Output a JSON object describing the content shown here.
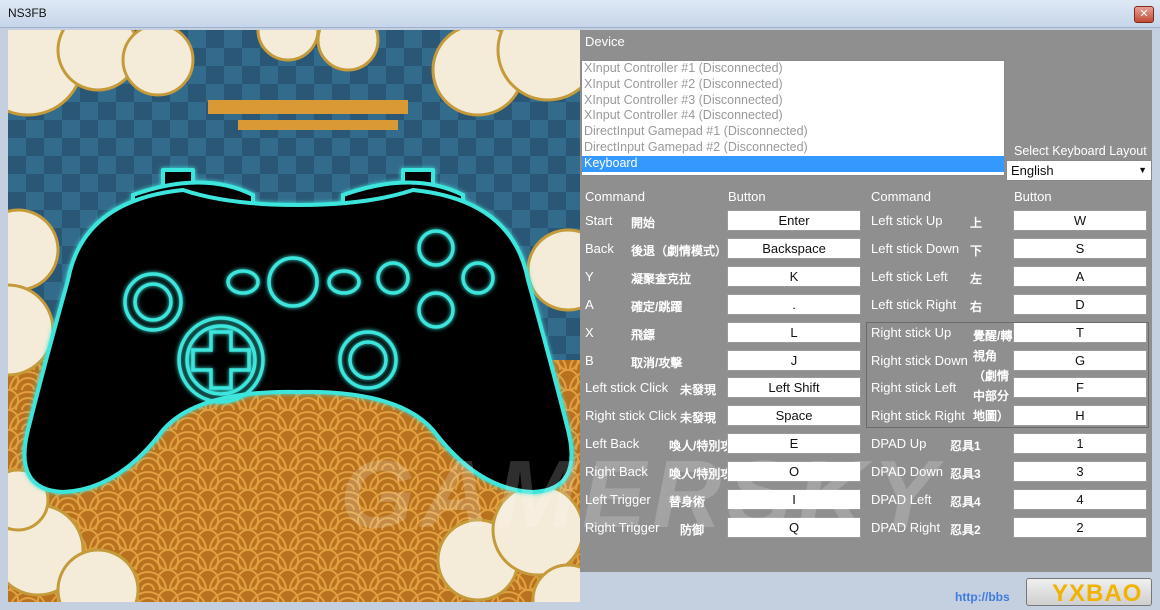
{
  "window": {
    "title": "NS3FB",
    "close_glyph": "✕"
  },
  "device": {
    "label": "Device",
    "items": [
      "XInput Controller #1 (Disconnected)",
      "XInput Controller #2 (Disconnected)",
      "XInput Controller #3 (Disconnected)",
      "XInput Controller #4 (Disconnected)",
      "DirectInput Gamepad #1 (Disconnected)",
      "DirectInput Gamepad #2 (Disconnected)",
      "Keyboard"
    ],
    "selected": "Keyboard"
  },
  "keyboard_layout": {
    "label": "Select Keyboard Layout",
    "value": "English"
  },
  "headers": {
    "command": "Command",
    "button": "Button"
  },
  "left_rows": [
    {
      "command": "Start",
      "desc": "開始",
      "button": "Enter"
    },
    {
      "command": "Back",
      "desc": "後退（劇情模式）",
      "button": "Backspace"
    },
    {
      "command": "Y",
      "desc": "凝聚查克拉",
      "button": "K"
    },
    {
      "command": "A",
      "desc": "確定/跳躍",
      "button": "."
    },
    {
      "command": "X",
      "desc": "飛鏢",
      "button": "L"
    },
    {
      "command": "B",
      "desc": "取消/攻擊",
      "button": "J"
    },
    {
      "command": "Left stick Click",
      "desc": "未發現",
      "button": "Left Shift"
    },
    {
      "command": "Right stick Click",
      "desc": "未發現",
      "button": "Space"
    },
    {
      "command": "Left Back",
      "desc": "喚人/特別攻擊",
      "button": "E"
    },
    {
      "command": "Right Back",
      "desc": "喚人/特別攻擊",
      "button": "O"
    },
    {
      "command": "Left Trigger",
      "desc": "替身術",
      "button": "I"
    },
    {
      "command": "Right Trigger",
      "desc": "防御",
      "button": "Q"
    }
  ],
  "right_rows_top": [
    {
      "command": "Left stick Up",
      "desc": "上",
      "button": "W"
    },
    {
      "command": "Left stick Down",
      "desc": "下",
      "button": "S"
    },
    {
      "command": "Left stick Left",
      "desc": "左",
      "button": "A"
    },
    {
      "command": "Left stick Right",
      "desc": "右",
      "button": "D"
    }
  ],
  "right_stick_rows": [
    {
      "command": "Right stick Up",
      "button": "T"
    },
    {
      "command": "Right stick Down",
      "button": "G"
    },
    {
      "command": "Right stick Left",
      "button": "F"
    },
    {
      "command": "Right stick Right",
      "button": "H"
    }
  ],
  "right_stick_desc": "覺醒/轉視角（劇情中部分地圖）",
  "right_rows_bottom": [
    {
      "command": "DPAD Up",
      "desc": "忍具1",
      "button": "1"
    },
    {
      "command": "DPAD Down",
      "desc": "忍具3",
      "button": "3"
    },
    {
      "command": "DPAD Left",
      "desc": "忍具4",
      "button": "4"
    },
    {
      "command": "DPAD Right",
      "desc": "忍具2",
      "button": "2"
    }
  ],
  "watermark": {
    "text": "GAMERSKY",
    "link": "http://bbs",
    "logo": "YXBAO"
  },
  "colors": {
    "panel": "#8f8f8f",
    "glow": "#3ee6dc",
    "selection": "#3399ff"
  }
}
